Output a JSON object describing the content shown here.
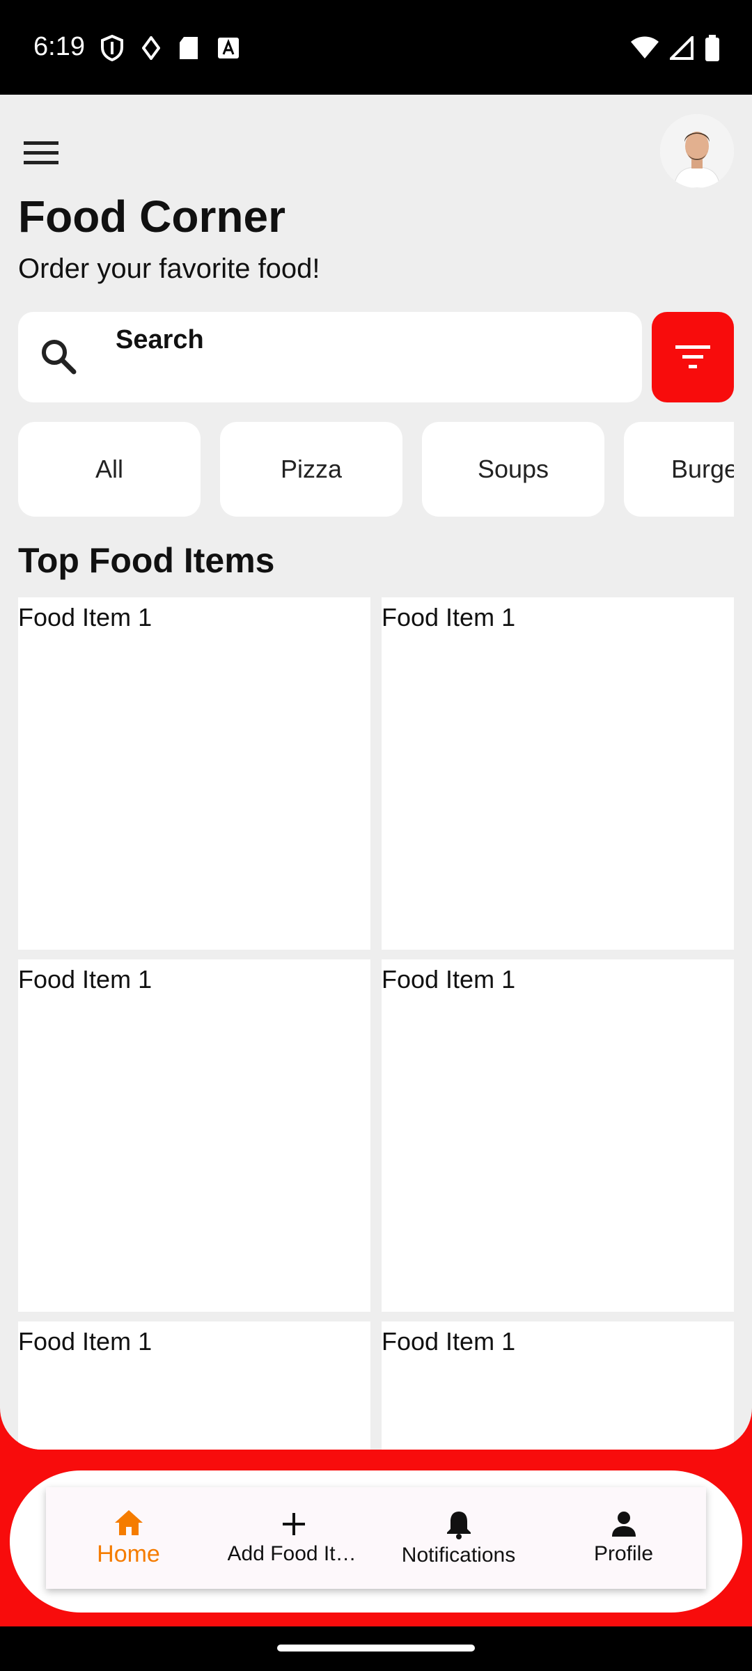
{
  "status_bar": {
    "time": "6:19"
  },
  "header": {
    "title": "Food Corner",
    "subtitle": "Order your favorite food!"
  },
  "search": {
    "placeholder": "Search",
    "value": ""
  },
  "categories": [
    "All",
    "Pizza",
    "Soups",
    "Burgers"
  ],
  "section_title": "Top Food Items",
  "food_items": [
    "Food Item 1",
    "Food Item 1",
    "Food Item 1",
    "Food Item 1",
    "Food Item 1",
    "Food Item 1"
  ],
  "bottom_nav": [
    {
      "label": "Home",
      "icon": "home-icon",
      "active": true
    },
    {
      "label": "Add Food Items",
      "icon": "plus-icon",
      "active": false
    },
    {
      "label": "Notifications",
      "icon": "bell-icon",
      "active": false
    },
    {
      "label": "Profile",
      "icon": "person-icon",
      "active": false
    }
  ],
  "colors": {
    "accent": "#f80c0c",
    "active_nav": "#f57c00",
    "background": "#eeeeee"
  }
}
